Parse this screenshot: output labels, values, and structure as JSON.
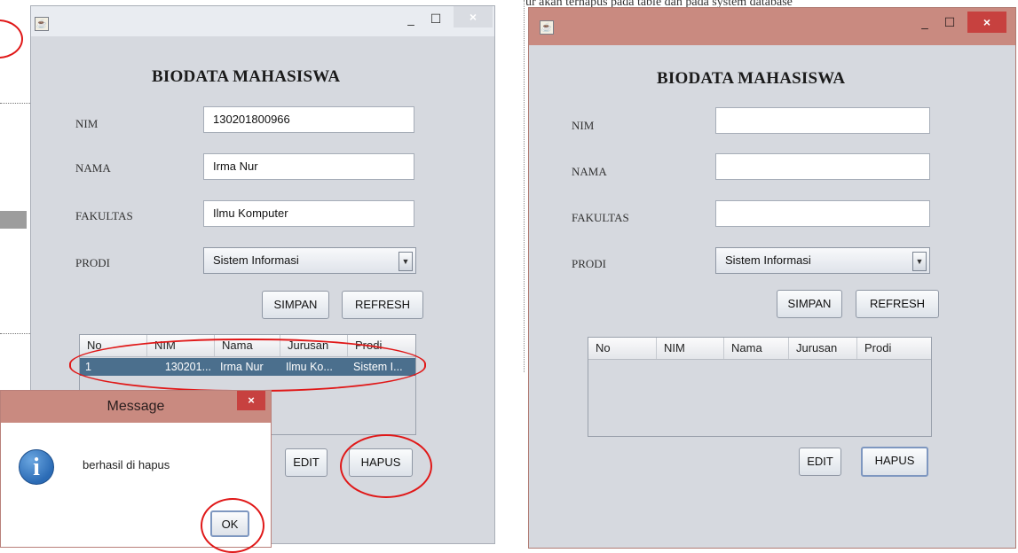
{
  "left_window": {
    "title_icon": "java-icon",
    "controls": {
      "minimize": "–",
      "maximize": "☐",
      "close": "×"
    },
    "heading": "BIODATA MAHASISWA",
    "fields": {
      "nim_label": "NIM",
      "nim_value": "130201800966",
      "nama_label": "NAMA",
      "nama_value": "Irma Nur",
      "fakultas_label": "FAKULTAS",
      "fakultas_value": "Ilmu Komputer",
      "prodi_label": "PRODI",
      "prodi_value": "Sistem Informasi"
    },
    "buttons": {
      "simpan": "SIMPAN",
      "refresh": "REFRESH",
      "edit": "EDIT",
      "hapus": "HAPUS"
    },
    "table": {
      "headers": [
        "No",
        "NIM",
        "Nama",
        "Jurusan",
        "Prodi"
      ],
      "rows": [
        [
          "1",
          "130201...",
          "Irma Nur",
          "Ilmu Ko...",
          "Sistem I..."
        ]
      ]
    }
  },
  "message_dialog": {
    "title": "Message",
    "close": "×",
    "icon": "info-icon",
    "icon_glyph": "i",
    "text": "berhasil di hapus",
    "ok": "OK"
  },
  "right_window": {
    "title_icon": "java-icon",
    "controls": {
      "minimize": "–",
      "maximize": "☐",
      "close": "×"
    },
    "heading": "BIODATA MAHASISWA",
    "fields": {
      "nim_label": "NIM",
      "nim_value": "",
      "nama_label": "NAMA",
      "nama_value": "",
      "fakultas_label": "FAKULTAS",
      "fakultas_value": "",
      "prodi_label": "PRODI",
      "prodi_value": "Sistem Informasi"
    },
    "buttons": {
      "simpan": "SIMPAN",
      "refresh": "REFRESH",
      "edit": "EDIT",
      "hapus": "HAPUS"
    },
    "table": {
      "headers": [
        "No",
        "NIM",
        "Nama",
        "Jurusan",
        "Prodi"
      ]
    }
  },
  "background_text": "ur akan terhapus pada table dan pada system database",
  "colors": {
    "selected_row": "#4b6f8d",
    "annotation_red": "#e01818",
    "dialog_titlebar": "#c98a80",
    "window_bg": "#d6d9df"
  }
}
